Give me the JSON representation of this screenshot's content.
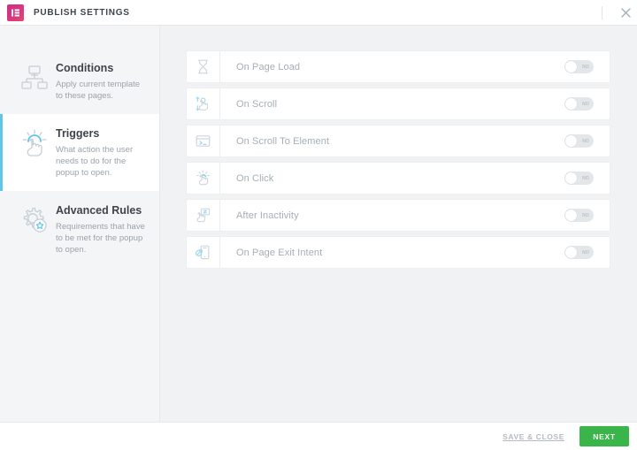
{
  "header": {
    "logo_icon": "elementor-logo-icon",
    "title": "PUBLISH SETTINGS",
    "close_icon": "close-icon",
    "accent_gradient_from": "#c9337f",
    "accent_gradient_to": "#e0476f"
  },
  "sidebar": {
    "items": [
      {
        "icon": "sitemap-icon",
        "label": "Conditions",
        "description": "Apply current template to these pages.",
        "active": false
      },
      {
        "icon": "pointing-hand-click-icon",
        "label": "Triggers",
        "description": "What action the user needs to do for the popup to open.",
        "active": true
      },
      {
        "icon": "gear-star-icon",
        "label": "Advanced Rules",
        "description": "Requirements that have to be met for the popup to open.",
        "active": false
      }
    ],
    "active_accent_color": "#5fc6ea"
  },
  "main": {
    "triggers": [
      {
        "icon": "hourglass-icon",
        "label": "On Page Load",
        "toggle_state": "NO"
      },
      {
        "icon": "scroll-hand-icon",
        "label": "On Scroll",
        "toggle_state": "NO"
      },
      {
        "icon": "code-window-icon",
        "label": "On Scroll To Element",
        "toggle_state": "NO"
      },
      {
        "icon": "click-hand-icon",
        "label": "On Click",
        "toggle_state": "NO"
      },
      {
        "icon": "sleeping-hand-icon",
        "label": "After Inactivity",
        "toggle_state": "NO"
      },
      {
        "icon": "phone-exit-icon",
        "label": "On Page Exit Intent",
        "toggle_state": "NO"
      }
    ]
  },
  "footer": {
    "save_close_label": "SAVE & CLOSE",
    "next_label": "NEXT",
    "next_color": "#39b54a"
  }
}
